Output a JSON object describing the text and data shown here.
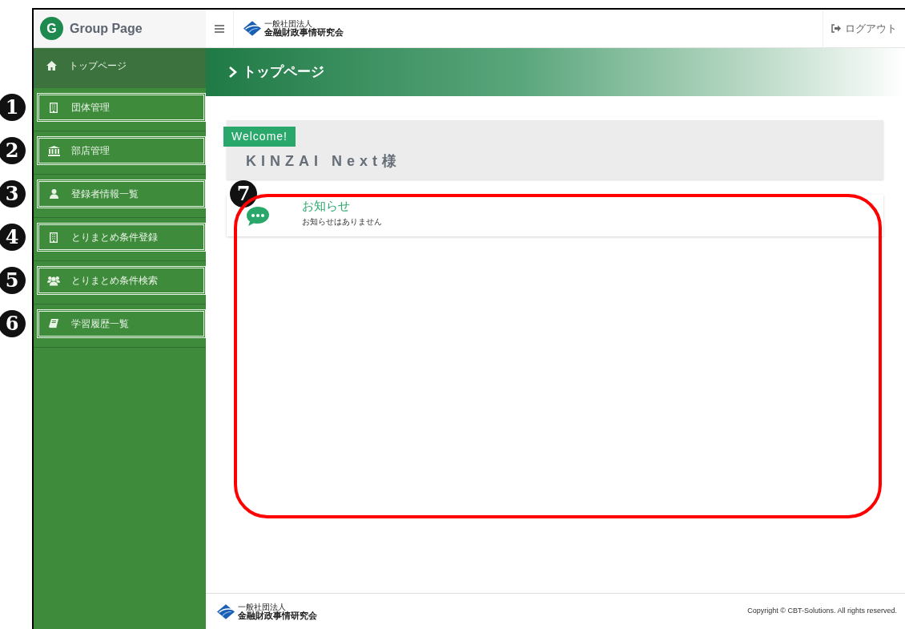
{
  "app": {
    "logo_letter": "G",
    "title": "Group Page"
  },
  "header": {
    "org_small": "一般社団法人",
    "org_name": "金融財政事情研究会",
    "logout": "ログアウト"
  },
  "sidebar": {
    "items": [
      {
        "label": "トップページ",
        "kind": "home",
        "selected": true
      },
      {
        "label": "団体管理",
        "kind": "building",
        "marker": "1",
        "selected": false
      },
      {
        "label": "部店管理",
        "kind": "bank",
        "marker": "2",
        "selected": false
      },
      {
        "label": "登録者情報一覧",
        "kind": "user",
        "marker": "3",
        "selected": false
      },
      {
        "label": "とりまとめ条件登録",
        "kind": "building",
        "marker": "4",
        "selected": false
      },
      {
        "label": "とりまとめ条件検索",
        "kind": "users",
        "marker": "5",
        "selected": false
      },
      {
        "label": "学習履歴一覧",
        "kind": "book",
        "marker": "6",
        "selected": false
      }
    ]
  },
  "breadcrumb": {
    "title": "トップページ"
  },
  "welcome": {
    "tag": "Welcome!",
    "name": "KINZAI Next様"
  },
  "notice": {
    "marker": "7",
    "title": "お知らせ",
    "message": "お知らせはありません"
  },
  "footer": {
    "org_small": "一般社団法人",
    "org_name": "金融財政事情研究会",
    "copyright": "Copyright © CBT-Solutions. All rights reserved."
  }
}
